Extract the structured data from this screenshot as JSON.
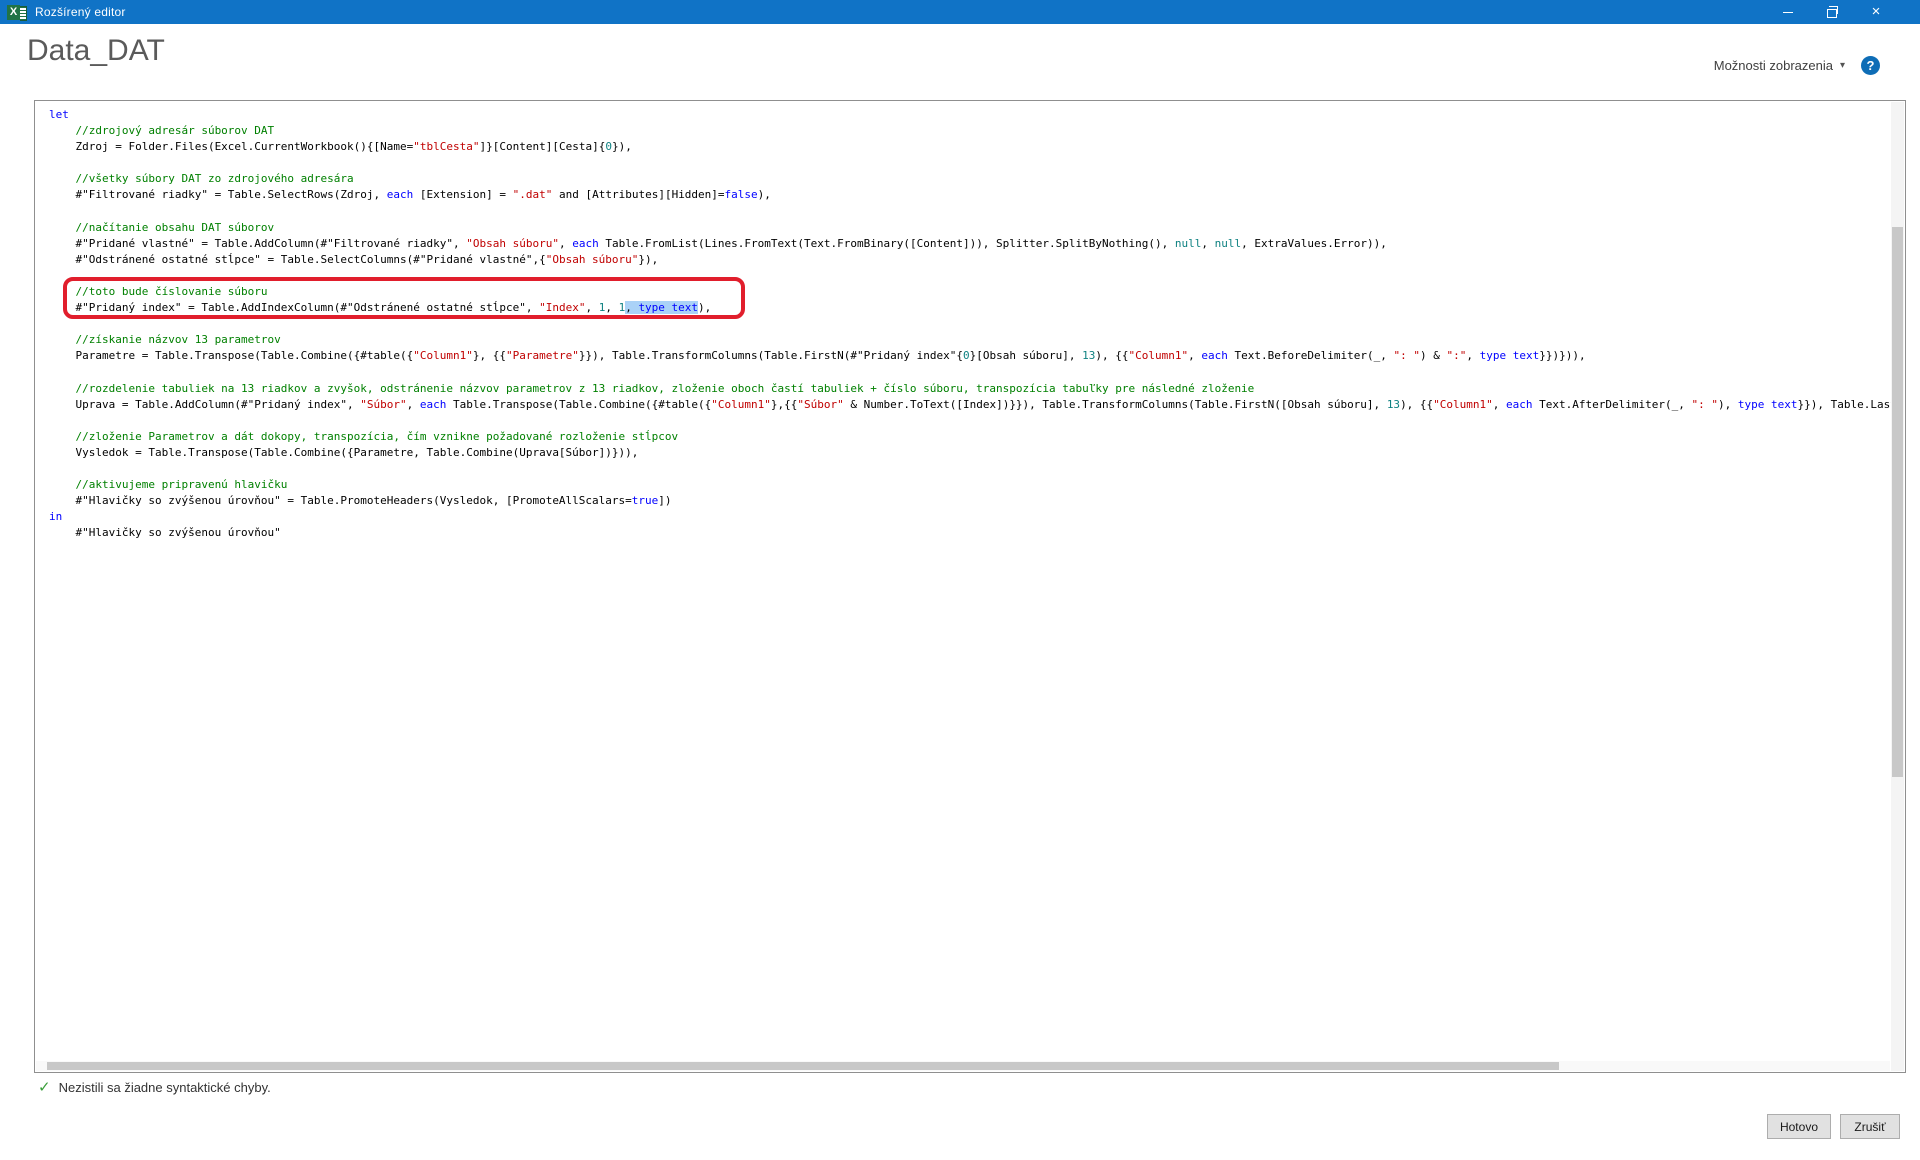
{
  "window": {
    "title": "Rozšírený editor"
  },
  "header": {
    "query_name": "Data_DAT",
    "display_options_label": "Možnosti zobrazenia",
    "chevron_glyph": "▾",
    "help_glyph": "?"
  },
  "editor": {
    "lines": [
      [
        [
          "k",
          "let"
        ]
      ],
      [
        [
          "c",
          "    //zdrojový adresár súborov DAT"
        ]
      ],
      [
        [
          "t",
          "    Zdroj = Folder.Files(Excel.CurrentWorkbook(){[Name="
        ],
        [
          "s",
          "\"tblCesta\""
        ],
        [
          "t",
          "]}[Content][Cesta]{"
        ],
        [
          "n",
          "0"
        ],
        [
          "t",
          "}),"
        ]
      ],
      [],
      [
        [
          "c",
          "    //všetky súbory DAT zo zdrojového adresára"
        ]
      ],
      [
        [
          "t",
          "    #\"Filtrované riadky\" = Table.SelectRows(Zdroj, "
        ],
        [
          "k",
          "each"
        ],
        [
          "t",
          " [Extension] = "
        ],
        [
          "s",
          "\".dat\""
        ],
        [
          "t",
          " and [Attributes][Hidden]="
        ],
        [
          "k",
          "false"
        ],
        [
          "t",
          "),"
        ]
      ],
      [],
      [
        [
          "c",
          "    //načítanie obsahu DAT súborov"
        ]
      ],
      [
        [
          "t",
          "    #\"Pridané vlastné\" = Table.AddColumn(#\"Filtrované riadky\", "
        ],
        [
          "s",
          "\"Obsah súboru\""
        ],
        [
          "t",
          ", "
        ],
        [
          "k",
          "each"
        ],
        [
          "t",
          " Table.FromList(Lines.FromText(Text.FromBinary([Content])), Splitter.SplitByNothing(), "
        ],
        [
          "n",
          "null"
        ],
        [
          "t",
          ", "
        ],
        [
          "n",
          "null"
        ],
        [
          "t",
          ", ExtraValues.Error)),"
        ]
      ],
      [
        [
          "t",
          "    #\"Odstránené ostatné stĺpce\" = Table.SelectColumns(#\"Pridané vlastné\",{"
        ],
        [
          "s",
          "\"Obsah súboru\""
        ],
        [
          "t",
          "}),"
        ]
      ],
      [],
      [
        [
          "c",
          "    //toto bude číslovanie súboru"
        ]
      ],
      [
        [
          "t",
          "    #\"Pridaný index\" = Table.AddIndexColumn(#\"Odstránené ostatné stĺpce\", "
        ],
        [
          "s",
          "\"Index\""
        ],
        [
          "t",
          ", "
        ],
        [
          "n",
          "1"
        ],
        [
          "t",
          ", "
        ],
        [
          "n",
          "1"
        ],
        [
          "t",
          ", ",
          1
        ],
        [
          "k",
          "type text",
          1
        ],
        [
          "t",
          "),"
        ]
      ],
      [],
      [
        [
          "c",
          "    //získanie názvov 13 parametrov"
        ]
      ],
      [
        [
          "t",
          "    Parametre = Table.Transpose(Table.Combine({#table({"
        ],
        [
          "s",
          "\"Column1\""
        ],
        [
          "t",
          "}, {{"
        ],
        [
          "s",
          "\"Parametre\""
        ],
        [
          "t",
          "}}), Table.TransformColumns(Table.FirstN(#\"Pridaný index\"{"
        ],
        [
          "n",
          "0"
        ],
        [
          "t",
          "}[Obsah súboru], "
        ],
        [
          "n",
          "13"
        ],
        [
          "t",
          "), {{"
        ],
        [
          "s",
          "\"Column1\""
        ],
        [
          "t",
          ", "
        ],
        [
          "k",
          "each"
        ],
        [
          "t",
          " Text.BeforeDelimiter(_, "
        ],
        [
          "s",
          "\": \""
        ],
        [
          "t",
          ") & "
        ],
        [
          "s",
          "\":\""
        ],
        [
          "t",
          ", "
        ],
        [
          "k",
          "type text"
        ],
        [
          "t",
          "}})})),"
        ]
      ],
      [],
      [
        [
          "c",
          "    //rozdelenie tabuliek na 13 riadkov a zvyšok, odstránenie názvov parametrov z 13 riadkov, zloženie oboch častí tabuliek + číslo súboru, transpozícia tabuľky pre následné zloženie"
        ]
      ],
      [
        [
          "t",
          "    Uprava = Table.AddColumn(#\"Pridaný index\", "
        ],
        [
          "s",
          "\"Súbor\""
        ],
        [
          "t",
          ", "
        ],
        [
          "k",
          "each"
        ],
        [
          "t",
          " Table.Transpose(Table.Combine({#table({"
        ],
        [
          "s",
          "\"Column1\""
        ],
        [
          "t",
          "},{{"
        ],
        [
          "s",
          "\"Súbor\""
        ],
        [
          "t",
          " & Number.ToText([Index])}}), Table.TransformColumns(Table.FirstN([Obsah súboru], "
        ],
        [
          "n",
          "13"
        ],
        [
          "t",
          "), {{"
        ],
        [
          "s",
          "\"Column1\""
        ],
        [
          "t",
          ", "
        ],
        [
          "k",
          "each"
        ],
        [
          "t",
          " Text.AfterDelimiter(_, "
        ],
        [
          "s",
          "\": \""
        ],
        [
          "t",
          "), "
        ],
        [
          "k",
          "type text"
        ],
        [
          "t",
          "}}), Table.Last"
        ]
      ],
      [],
      [
        [
          "c",
          "    //zloženie Parametrov a dát dokopy, transpozícia, čím vznikne požadované rozloženie stĺpcov"
        ]
      ],
      [
        [
          "t",
          "    Vysledok = Table.Transpose(Table.Combine({Parametre, Table.Combine(Uprava[Súbor])})),"
        ]
      ],
      [],
      [
        [
          "c",
          "    //aktivujeme pripravenú hlavičku"
        ]
      ],
      [
        [
          "t",
          "    #\"Hlavičky so zvýšenou úrovňou\" = Table.PromoteHeaders(Vysledok, [PromoteAllScalars="
        ],
        [
          "k",
          "true"
        ],
        [
          "t",
          "])"
        ]
      ],
      [
        [
          "k",
          "in"
        ]
      ],
      [
        [
          "t",
          "    #\"Hlavičky so zvýšenou úrovňou\""
        ]
      ]
    ]
  },
  "status": {
    "check_glyph": "✓",
    "message": "Nezistili sa žiadne syntaktické chyby."
  },
  "footer": {
    "done_label": "Hotovo",
    "cancel_label": "Zrušiť"
  },
  "colors": {
    "titlebar": "#1073c6",
    "excel_green": "#217346",
    "comment": "#008000",
    "string": "#c00000",
    "keyword": "#0000ff",
    "literal": "#0e8181",
    "selection": "#aad2f7",
    "annotation_box": "#e11e2c",
    "check": "#3a9e3a",
    "help_icon": "#0e6db6"
  }
}
